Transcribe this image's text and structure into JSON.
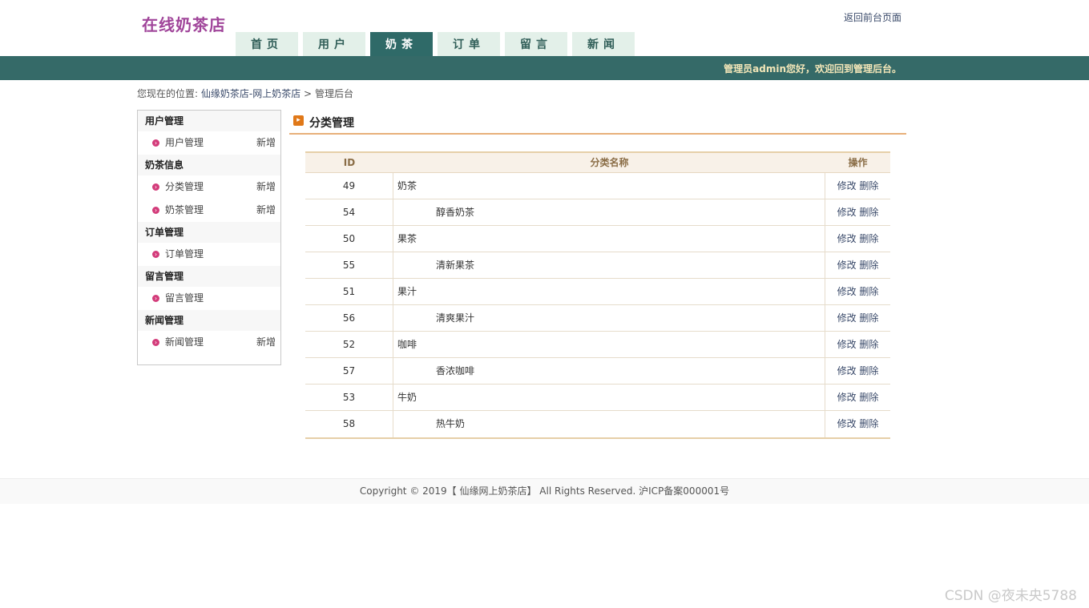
{
  "header": {
    "logo": "在线奶茶店",
    "top_link": "返回前台页面",
    "welcome": "管理员admin您好，欢迎回到管理后台。"
  },
  "nav": [
    {
      "label": "首页"
    },
    {
      "label": "用户"
    },
    {
      "label": "奶茶",
      "active": true
    },
    {
      "label": "订单"
    },
    {
      "label": "留言"
    },
    {
      "label": "新闻"
    }
  ],
  "breadcrumb": {
    "prefix": "您现在的位置:",
    "link": "仙缘奶茶店-网上奶茶店",
    "sep": ">",
    "current": "管理后台"
  },
  "sidebar": {
    "sections": [
      {
        "title": "用户管理",
        "items": [
          {
            "label": "用户管理",
            "add": "新增"
          }
        ]
      },
      {
        "title": "奶茶信息",
        "items": [
          {
            "label": "分类管理",
            "add": "新增"
          },
          {
            "label": "奶茶管理",
            "add": "新增"
          }
        ]
      },
      {
        "title": "订单管理",
        "items": [
          {
            "label": "订单管理"
          }
        ]
      },
      {
        "title": "留言管理",
        "items": [
          {
            "label": "留言管理"
          }
        ]
      },
      {
        "title": "新闻管理",
        "items": [
          {
            "label": "新闻管理",
            "add": "新增"
          }
        ]
      }
    ]
  },
  "main": {
    "title": "分类管理",
    "table": {
      "headers": {
        "id": "ID",
        "name": "分类名称",
        "op": "操作"
      },
      "edit": "修改",
      "delete": "删除",
      "rows": [
        {
          "id": "49",
          "name": "奶茶",
          "child": false
        },
        {
          "id": "54",
          "name": "醇香奶茶",
          "child": true
        },
        {
          "id": "50",
          "name": "果茶",
          "child": false
        },
        {
          "id": "55",
          "name": "清新果茶",
          "child": true
        },
        {
          "id": "51",
          "name": "果汁",
          "child": false
        },
        {
          "id": "56",
          "name": "清爽果汁",
          "child": true
        },
        {
          "id": "52",
          "name": "咖啡",
          "child": false
        },
        {
          "id": "57",
          "name": "香浓咖啡",
          "child": true
        },
        {
          "id": "53",
          "name": "牛奶",
          "child": false
        },
        {
          "id": "58",
          "name": "热牛奶",
          "child": true
        }
      ]
    }
  },
  "footer": {
    "text": "Copyright © 2019【 仙缘网上奶茶店】 All Rights Reserved. 沪ICP备案000001号"
  },
  "watermark": "CSDN @夜未央5788"
}
